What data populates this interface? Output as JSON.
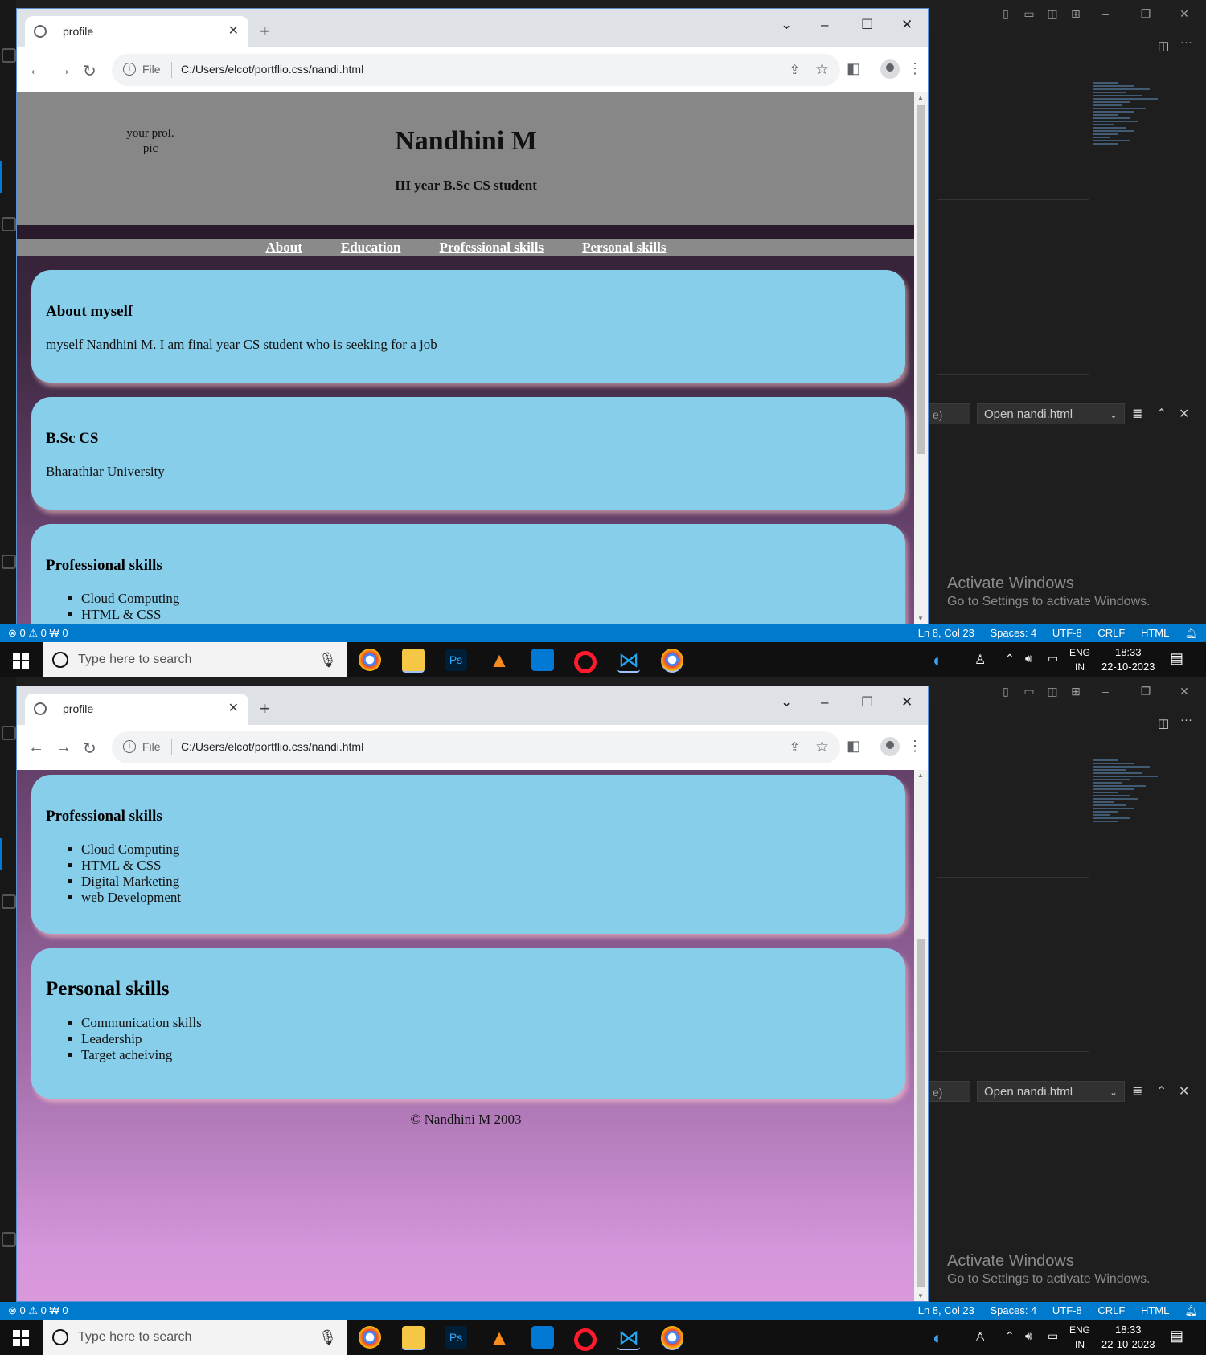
{
  "browser": {
    "tab_title": "profile",
    "file_label": "File",
    "url": "C:/Users/elcot/portflio.css/nandi.html"
  },
  "profile": {
    "pic_alt": "your prol.\npic",
    "name": "Nandhini M",
    "subtitle": "III year B.Sc CS student",
    "nav": [
      "About",
      "Education",
      "Professional skills",
      "Personal skills"
    ],
    "about_title": "About myself",
    "about_text": "myself Nandhini M. I am final year CS student who is seeking for a job",
    "edu_title": "B.Sc CS",
    "edu_text": "Bharathiar University",
    "pro_title": "Professional skills",
    "pro_skills": [
      "Cloud Computing",
      "HTML & CSS",
      "Digital Marketing",
      "web Development"
    ],
    "personal_title": "Personal skills",
    "personal_skills": [
      "Communication skills",
      "Leadership",
      "Target acheiving"
    ],
    "footer": "© Nandhini M 2003"
  },
  "vscode": {
    "open_dropdown": "Open nandi.html",
    "find_fragment": "e)",
    "status_left": "⊗ 0 ⚠ 0   ₩ 0",
    "status_pos": "Ln 8, Col 23",
    "status_spaces": "Spaces: 4",
    "status_encoding": "UTF-8",
    "status_eol": "CRLF",
    "status_lang": "HTML",
    "activate_title": "Activate Windows",
    "activate_sub": "Go to Settings to activate Windows."
  },
  "taskbar": {
    "search_placeholder": "Type here to search",
    "lang_top": "ENG",
    "lang_bottom": "IN",
    "time": "18:33",
    "date": "22-10-2023"
  },
  "colors": {
    "card": "#87ceeb",
    "header": "#878787",
    "statusbar": "#007acc"
  }
}
